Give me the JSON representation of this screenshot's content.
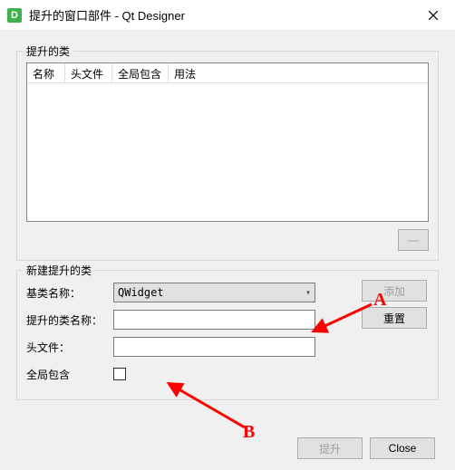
{
  "window": {
    "icon_letter": "D",
    "title": "提升的窗口部件 - Qt Designer"
  },
  "group1": {
    "legend": "提升的类",
    "columns": {
      "name": "名称",
      "header": "头文件",
      "global": "全局包含",
      "usage": "用法"
    },
    "remove_symbol": "—"
  },
  "group2": {
    "legend": "新建提升的类",
    "labels": {
      "base_class": "基类名称：",
      "promoted_class": "提升的类名称：",
      "header_file": "头文件：",
      "global_include": "全局包含"
    },
    "base_class_value": "QWidget",
    "buttons": {
      "add": "添加",
      "reset": "重置"
    }
  },
  "bottom": {
    "promote": "提升",
    "close": "Close"
  },
  "annotations": {
    "A": "A",
    "B": "B"
  }
}
